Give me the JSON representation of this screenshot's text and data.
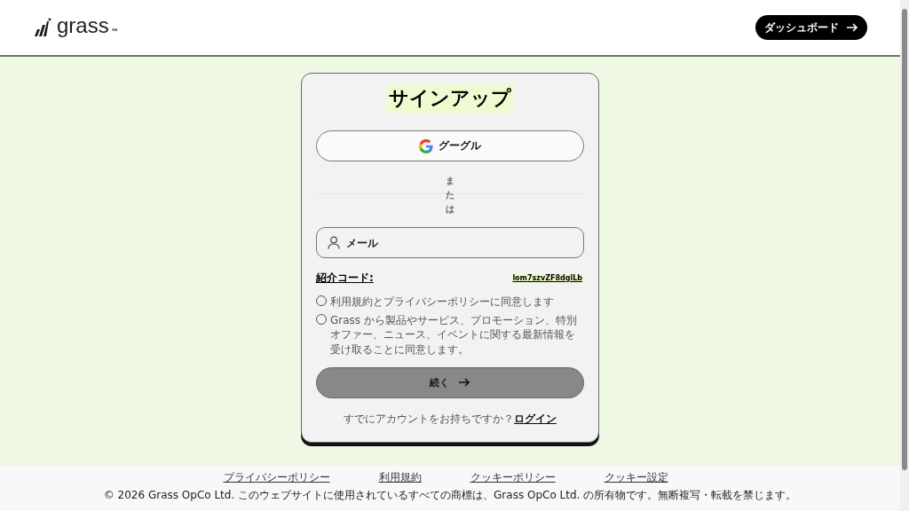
{
  "header": {
    "logo": "grass",
    "trademark": "™",
    "dashboard_button": "ダッシュボード"
  },
  "signup": {
    "title": "サインアップ",
    "google_button": "グーグル",
    "divider": "または",
    "email_field": {
      "placeholder": "メール"
    },
    "referral": {
      "label": "紹介コード:",
      "code": "lom7szvZF8dglLb"
    },
    "consents": [
      {
        "text": "利用規約とプライバシーポリシーに同意します",
        "checked": false
      },
      {
        "text": "Grass から製品やサービス、プロモーション、特別オファー、ニュース、イベントに関する最新情報を受け取ることに同意します。",
        "checked": false
      }
    ],
    "continue_button": {
      "label": "続く",
      "disabled": true
    },
    "login_prompt": {
      "text": "すでにアカウントをお持ちですか？",
      "link": "ログイン"
    }
  },
  "footer": {
    "links": [
      "プライバシーポリシー",
      "利用規約",
      "クッキーポリシー",
      "クッキー設定"
    ],
    "copyright": "© 2026 Grass OpCo Ltd. このウェブサイトに使用されているすべての商標は、Grass OpCo Ltd. の所有物です。無断複写・転載を禁じます。"
  }
}
